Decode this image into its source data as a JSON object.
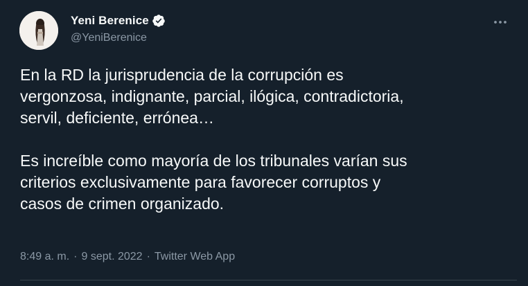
{
  "author": {
    "name": "Yeni Berenice",
    "handle": "@YeniBerenice",
    "verified": true
  },
  "tweet": {
    "paragraph1": [
      "En la RD la jurisprudencia de la corrupción es",
      "vergonzosa, indignante, parcial, ilógica, contradictoria,",
      "servil, deficiente, errónea…"
    ],
    "paragraph2": [
      "Es increíble como mayoría de los tribunales varían sus",
      "criterios exclusivamente para favorecer corruptos y",
      "casos de crimen organizado."
    ]
  },
  "meta": {
    "time": "8:49 a. m.",
    "separator": "·",
    "date": "9 sept. 2022",
    "source": "Twitter Web App"
  },
  "icons": {
    "verified": "verified-badge-icon",
    "more": "more-options-icon"
  },
  "colors": {
    "background": "#15202b",
    "text": "#f7f9f9",
    "secondary_text": "#8b98a5",
    "verified_badge": "#f7f9f9",
    "divider": "#38444d"
  }
}
